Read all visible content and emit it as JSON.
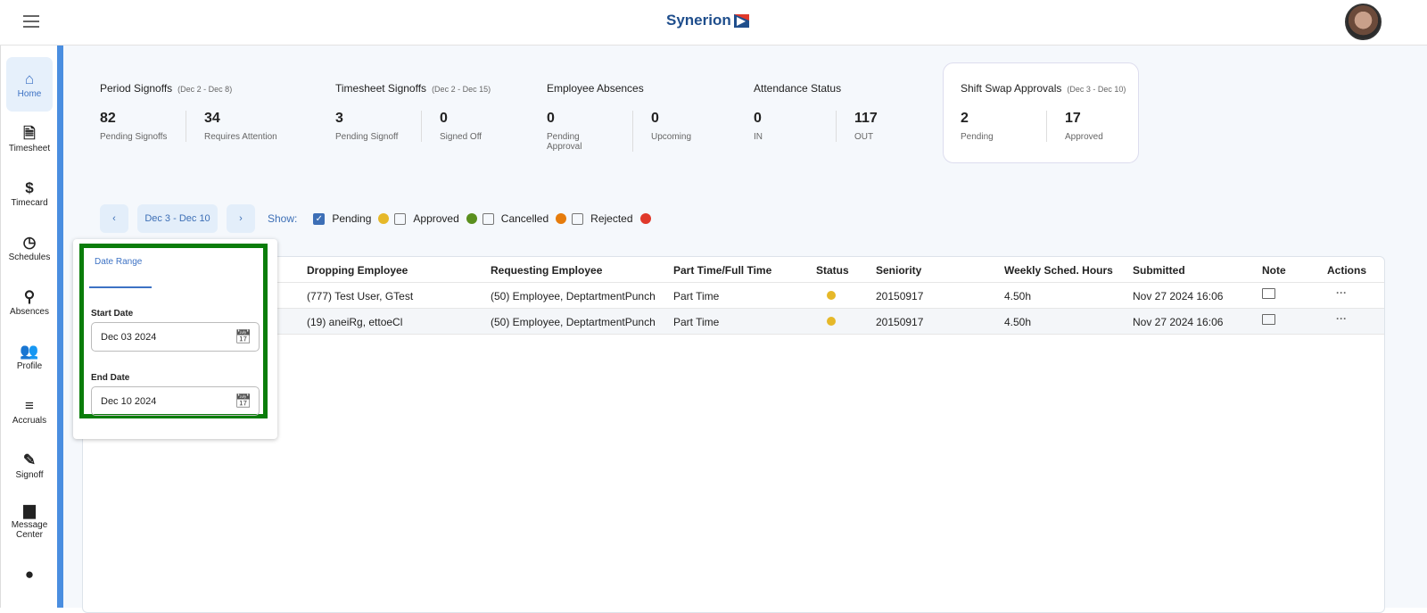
{
  "header": {
    "logo": "Synerion"
  },
  "sidebar": {
    "items": [
      {
        "label": "Home",
        "icon": "home-icon",
        "glyph": "⌂"
      },
      {
        "label": "Timesheet",
        "icon": "document-icon",
        "glyph": "🗎"
      },
      {
        "label": "Timecard",
        "icon": "dollar-icon",
        "glyph": "$"
      },
      {
        "label": "Schedules",
        "icon": "clock-icon",
        "glyph": "◷"
      },
      {
        "label": "Absences",
        "icon": "person-remove-icon",
        "glyph": "⚲"
      },
      {
        "label": "Profile",
        "icon": "people-icon",
        "glyph": "👥"
      },
      {
        "label": "Accruals",
        "icon": "accruals-icon",
        "glyph": "≡"
      },
      {
        "label": "Signoff",
        "icon": "signoff-icon",
        "glyph": "✎"
      },
      {
        "label": "Message Center",
        "icon": "chat-icon",
        "glyph": "▆"
      },
      {
        "label": "",
        "icon": "person-icon",
        "glyph": "●"
      }
    ]
  },
  "stats": [
    {
      "title": "Period Signoffs",
      "range": "(Dec 2 - Dec 8)",
      "a": {
        "value": "82",
        "label": "Pending Signoffs"
      },
      "b": {
        "value": "34",
        "label": "Requires Attention"
      }
    },
    {
      "title": "Timesheet Signoffs",
      "range": "(Dec 2 - Dec 15)",
      "a": {
        "value": "3",
        "label": "Pending Signoff"
      },
      "b": {
        "value": "0",
        "label": "Signed Off"
      }
    },
    {
      "title": "Employee Absences",
      "range": "",
      "a": {
        "value": "0",
        "label": "Pending Approval"
      },
      "b": {
        "value": "0",
        "label": "Upcoming"
      }
    },
    {
      "title": "Attendance Status",
      "range": "",
      "a": {
        "value": "0",
        "label": "IN"
      },
      "b": {
        "value": "117",
        "label": "OUT"
      }
    },
    {
      "title": "Shift Swap Approvals",
      "range": "(Dec 3 - Dec 10)",
      "a": {
        "value": "2",
        "label": "Pending"
      },
      "b": {
        "value": "17",
        "label": "Approved"
      }
    }
  ],
  "filters": {
    "prev": "‹",
    "range": "Dec 3 - Dec 10",
    "next": "›",
    "show": "Show:",
    "options": [
      {
        "label": "Pending",
        "checked": true,
        "color": "#e6b829"
      },
      {
        "label": "Approved",
        "checked": false,
        "color": "#5a8f1e"
      },
      {
        "label": "Cancelled",
        "checked": false,
        "color": "#e67c0c"
      },
      {
        "label": "Rejected",
        "checked": false,
        "color": "#e0392b"
      }
    ]
  },
  "table": {
    "headers": [
      "Dropping Employee",
      "Requesting Employee",
      "Part Time/Full Time",
      "Status",
      "Seniority",
      "Weekly Sched. Hours",
      "Submitted",
      "Note",
      "Actions"
    ],
    "rows": [
      [
        "(777) Test User, GTest",
        "(50) Employee, DeptartmentPunch",
        "Part Time",
        "#e6b829",
        "20150917",
        "4.50h",
        "Nov 27 2024 16:06"
      ],
      [
        "(19) aneiRg, ettoeCl",
        "(50) Employee, DeptartmentPunch",
        "Part Time",
        "#e6b829",
        "20150917",
        "4.50h",
        "Nov 27 2024 16:06"
      ]
    ]
  },
  "popover": {
    "tab": "Date Range",
    "start_label": "Start Date",
    "start_value": "Dec 03 2024",
    "end_label": "End Date",
    "end_value": "Dec 10 2024"
  }
}
